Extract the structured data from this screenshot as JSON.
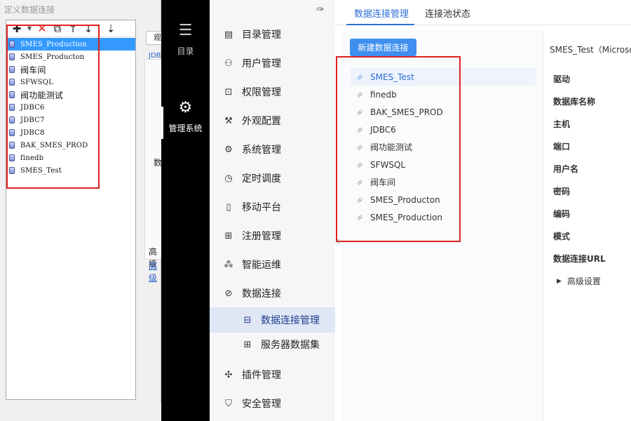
{
  "dialog": {
    "title": "定义数据连接",
    "connections": [
      "SMES_Production",
      "SMES_Producton",
      "阀车间",
      "SFWSQL",
      "阀功能测试",
      "JDBC6",
      "JDBC7",
      "JDBC8",
      "BAK_SMES_PROD",
      "finedb",
      "SMES_Test"
    ],
    "selected_index": 0,
    "combo_value": "观",
    "jdbc_label": "JDBC",
    "truncated_label": "数",
    "advanced_label": "高级",
    "advanced_link": "高级"
  },
  "app_sidebar": {
    "catalog_label": "目录",
    "manage_label": "管理系统"
  },
  "nav": {
    "items": [
      "目录管理",
      "用户管理",
      "权限管理",
      "外观配置",
      "系统管理",
      "定时调度",
      "移动平台",
      "注册管理",
      "智能运维",
      "数据连接"
    ],
    "sub_items": [
      "数据连接管理",
      "服务器数据集"
    ],
    "tail_items": [
      "插件管理",
      "安全管理"
    ]
  },
  "tabs": [
    "数据连接管理",
    "连接池状态"
  ],
  "list": {
    "new_button": "新建数据连接",
    "items": [
      "SMES_Test",
      "finedb",
      "BAK_SMES_PROD",
      "JDBC6",
      "阀功能测试",
      "SFWSQL",
      "阀车间",
      "SMES_Producton",
      "SMES_Production"
    ],
    "active_index": 0
  },
  "detail": {
    "title": "SMES_Test（Microso",
    "fields": [
      "驱动",
      "数据库名称",
      "主机",
      "端口",
      "用户名",
      "密码",
      "编码",
      "模式",
      "数据连接URL"
    ],
    "advanced": "高级设置"
  },
  "colors": {
    "accent": "#2c6fd6",
    "button": "#3e8ff0",
    "highlight_box": "#e02020",
    "selection": "#3399ff"
  }
}
